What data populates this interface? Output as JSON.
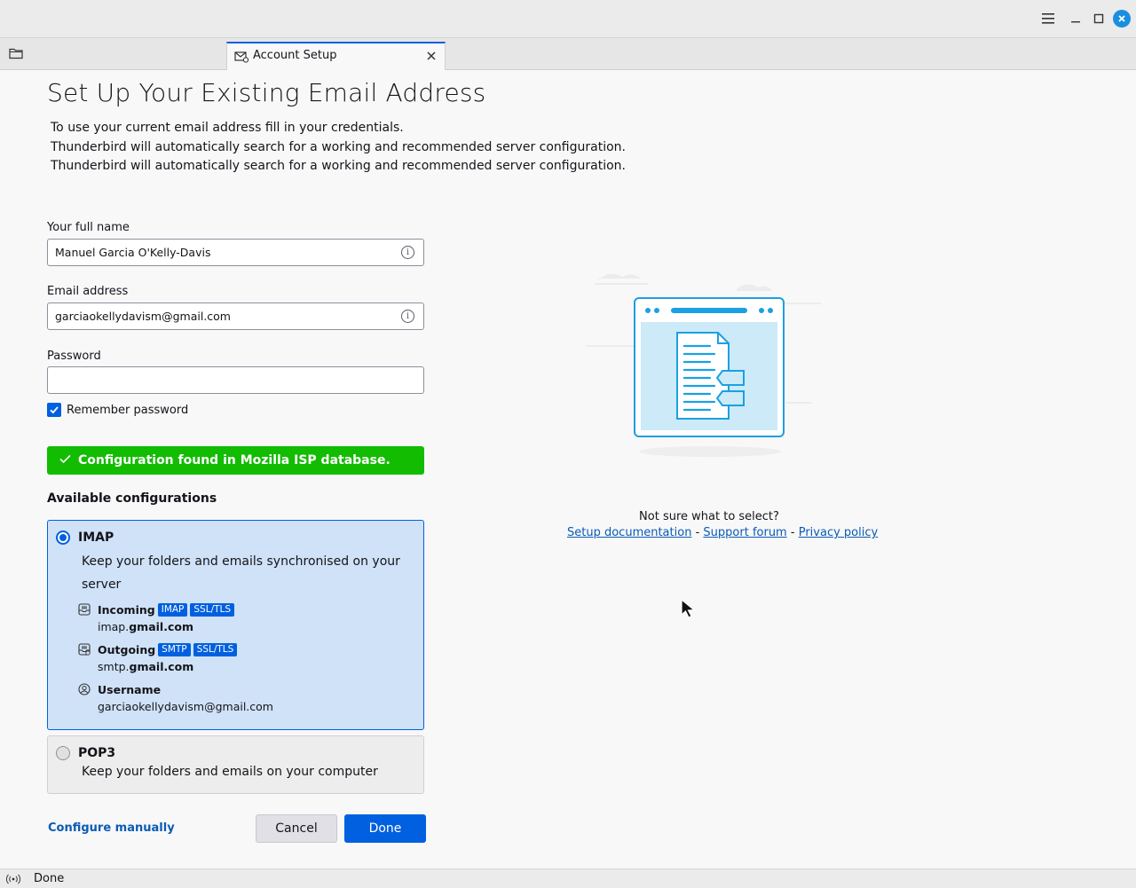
{
  "window": {
    "menu_icon": "hamburger-menu-icon",
    "minimize_icon": "minimize-icon",
    "maximize_icon": "maximize-icon",
    "close_icon": "close-icon"
  },
  "tabs": {
    "folder_icon": "folder-icon",
    "active_tab": {
      "label": "Account Setup",
      "icon": "mail-setup-icon"
    }
  },
  "page": {
    "title": "Set Up Your Existing Email Address",
    "intro_line1": "To use your current email address fill in your credentials.",
    "intro_line2": "Thunderbird will automatically search for a working and recommended server configuration.",
    "intro_line3": "Thunderbird will automatically search for a working and recommended server configuration."
  },
  "form": {
    "fullname_label": "Your full name",
    "fullname_value": "Manuel Garcia O'Kelly-Davis",
    "email_label": "Email address",
    "email_value": "garciaokellydavism@gmail.com",
    "password_label": "Password",
    "password_value": "",
    "remember_label": "Remember password",
    "remember_checked": true
  },
  "status": {
    "success_message": "Configuration found in Mozilla ISP database.",
    "success_color": "#12bc00"
  },
  "configs": {
    "heading": "Available configurations",
    "imap": {
      "title": "IMAP",
      "description": "Keep your folders and emails synchronised on your server",
      "selected": true,
      "incoming_label": "Incoming",
      "incoming_badge1": "IMAP",
      "incoming_badge2": "SSL/TLS",
      "incoming_host_prefix": "imap.",
      "incoming_host_domain": "gmail.com",
      "outgoing_label": "Outgoing",
      "outgoing_badge1": "SMTP",
      "outgoing_badge2": "SSL/TLS",
      "outgoing_host_prefix": "smtp.",
      "outgoing_host_domain": "gmail.com",
      "username_label": "Username",
      "username_value": "garciaokellydavism@gmail.com"
    },
    "pop3": {
      "title": "POP3",
      "description": "Keep your folders and emails on your computer",
      "selected": false
    }
  },
  "actions": {
    "configure_manually": "Configure manually",
    "cancel": "Cancel",
    "done": "Done"
  },
  "help": {
    "question": "Not sure what to select?",
    "link_docs": "Setup documentation",
    "link_forum": "Support forum",
    "link_privacy": "Privacy policy",
    "separator": "-"
  },
  "statusbar": {
    "icon": "activity-icon",
    "text": "Done"
  },
  "colors": {
    "accent": "#0060df",
    "selected_card_bg": "#cfe2f7",
    "link": "#0a5bb5"
  }
}
